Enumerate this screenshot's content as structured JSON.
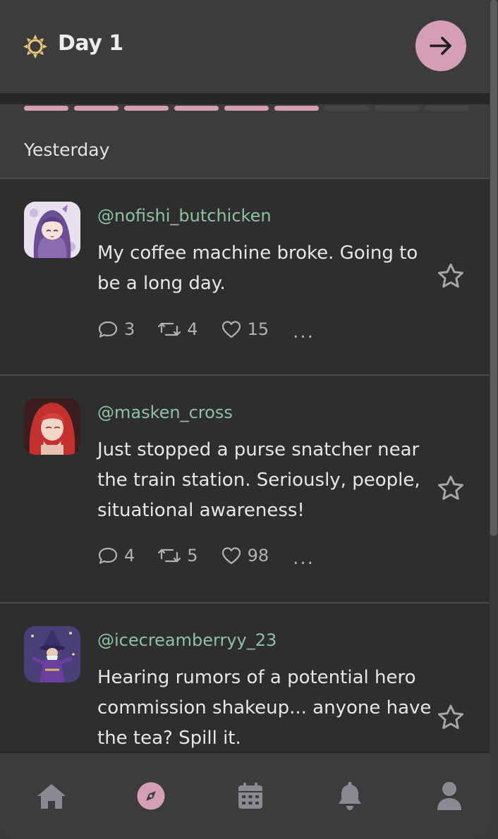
{
  "header": {
    "icon": "sun-icon",
    "title": "Day 1",
    "next_icon": "arrow-right-icon"
  },
  "progress": {
    "segments_total": 9,
    "segments_filled": 6,
    "accent": "#d49fb4"
  },
  "section": {
    "label": "Yesterday"
  },
  "colors": {
    "handle": "#8fc0a6",
    "accent": "#d49fb4",
    "background": "#2e2e2e"
  },
  "posts": [
    {
      "handle": "@nofishi_butchicken",
      "lines": [
        "My coffee machine broke. Going to",
        "be a long day."
      ],
      "replies": "3",
      "reposts": "4",
      "likes": "15",
      "more": "..."
    },
    {
      "handle": "@masken_cross",
      "lines": [
        "Just stopped a purse snatcher near",
        "the train station. Seriously, people,",
        "situational awareness!"
      ],
      "replies": "4",
      "reposts": "5",
      "likes": "98",
      "more": "..."
    },
    {
      "handle": "@icecreamberryy_23",
      "lines": [
        "Hearing rumors of a potential hero",
        "commission shakeup... anyone have",
        "the tea? Spill it."
      ]
    }
  ],
  "nav": {
    "items": [
      "home-icon",
      "compass-icon",
      "calendar-icon",
      "bell-icon",
      "user-icon"
    ],
    "active": "compass-icon"
  }
}
